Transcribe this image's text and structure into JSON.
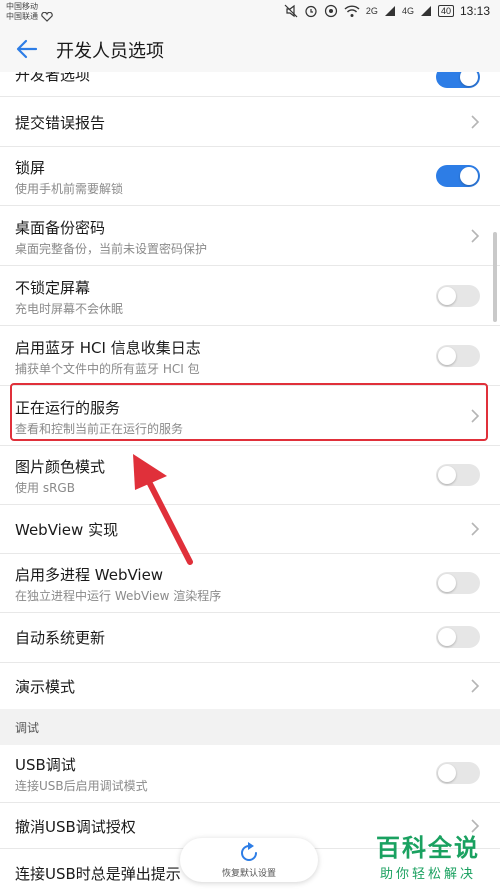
{
  "status": {
    "carrier1": "中国移动",
    "carrier2": "中国联通",
    "net1": "2G",
    "net2": "4G",
    "battery": "40",
    "time": "13:13"
  },
  "appbar": {
    "title": "开发人员选项"
  },
  "items": [
    {
      "title": "开发者选项",
      "type": "toggle",
      "on": true
    },
    {
      "title": "提交错误报告",
      "type": "chevron"
    },
    {
      "title": "锁屏",
      "sub": "使用手机前需要解锁",
      "type": "toggle",
      "on": true
    },
    {
      "title": "桌面备份密码",
      "sub": "桌面完整备份，当前未设置密码保护",
      "type": "chevron"
    },
    {
      "title": "不锁定屏幕",
      "sub": "充电时屏幕不会休眠",
      "type": "toggle",
      "on": false
    },
    {
      "title": "启用蓝牙 HCI 信息收集日志",
      "sub": "捕获单个文件中的所有蓝牙 HCI 包",
      "type": "toggle",
      "on": false
    },
    {
      "title": "正在运行的服务",
      "sub": "查看和控制当前正在运行的服务",
      "type": "chevron"
    },
    {
      "title": "图片颜色模式",
      "sub": "使用 sRGB",
      "type": "toggle",
      "on": false
    },
    {
      "title": "WebView 实现",
      "type": "chevron"
    },
    {
      "title": "启用多进程 WebView",
      "sub": "在独立进程中运行 WebView 渲染程序",
      "type": "toggle",
      "on": false
    },
    {
      "title": "自动系统更新",
      "type": "toggle",
      "on": false
    },
    {
      "title": "演示模式",
      "type": "chevron"
    },
    {
      "title": "USB调试",
      "sub": "连接USB后启用调试模式",
      "type": "toggle",
      "on": false
    },
    {
      "title": "撤消USB调试授权",
      "type": "chevron"
    },
    {
      "title": "连接USB时总是弹出提示",
      "type": "chevron"
    }
  ],
  "section_debug": "调试",
  "restore": {
    "label": "恢复默认设置"
  },
  "watermark": {
    "title": "百科全说",
    "sub": "助你轻松解决"
  },
  "colors": {
    "accent": "#2d7de6",
    "highlight": "#e0303a",
    "watermark": "#1aa160"
  }
}
